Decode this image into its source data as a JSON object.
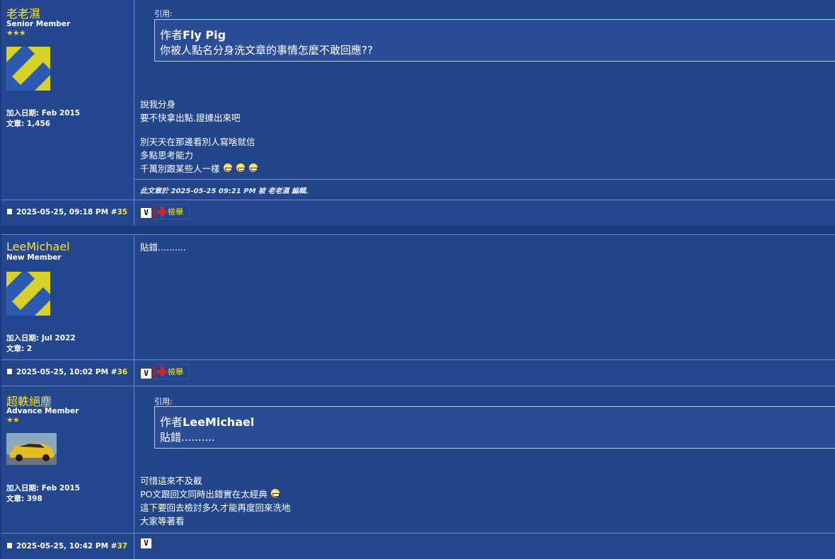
{
  "posts": [
    {
      "username": "老老濕",
      "rank": "Senior Member",
      "stars": "★★★",
      "join_date": "加入日期: Feb 2015",
      "post_count": "文章: 1,456",
      "quote_label": "引用:",
      "quote_author_prefix": "作者",
      "quote_author": "Fly Pig",
      "quote_text": "你被人點名分身洗文章的事情怎麼不敢回應??",
      "lines": [
        "說我分身",
        "要不快拿出點.證據出來吧",
        "別天天在那邊看別人寫啥就信",
        "多點思考能力",
        "千萬別跟某些人一樣"
      ],
      "edit_note": "此文章於 2025-05-25 09:21 PM 被 老老濕 編輯.",
      "post_date": "2025-05-25, 09:18 PM #",
      "post_number": "35",
      "report_label": "檢舉"
    },
    {
      "username": "LeeMichael",
      "rank": "New Member",
      "join_date": "加入日期: Jul 2022",
      "post_count": "文章: 2",
      "lines": [
        "貼錯.........."
      ],
      "post_date": "2025-05-25, 10:02 PM #",
      "post_number": "36",
      "report_label": "檢舉"
    },
    {
      "username": "超軼絕塵",
      "rank": "Advance Member",
      "stars": "★★",
      "join_date": "加入日期: Feb 2015",
      "post_count": "文章: 398",
      "quote_label": "引用:",
      "quote_author_prefix": "作者",
      "quote_author": "LeeMichael",
      "quote_text": "貼錯..........",
      "lines": [
        "可惜這來不及截",
        "PO文跟回文同時出錯實在太經典",
        "這下要回去檢討多久才能再度回來洗地",
        "大家等著看"
      ],
      "post_date": "2025-05-25, 10:42 PM #",
      "post_number": "37"
    }
  ]
}
